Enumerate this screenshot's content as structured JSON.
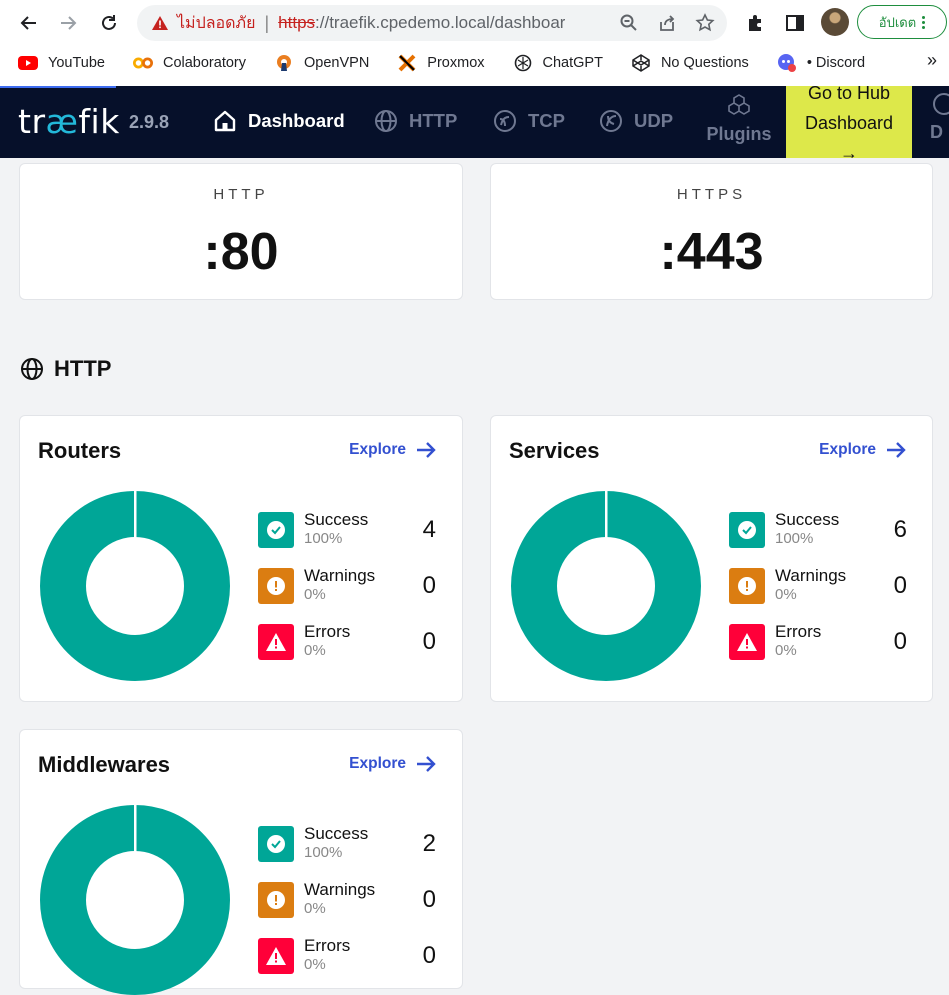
{
  "browser": {
    "insecure_label": "ไม่ปลอดภัย",
    "url_scheme": "https",
    "url_rest": "://traefik.cpedemo.local/dashboard...",
    "update_label": "อัปเดต",
    "bookmarks": [
      {
        "label": "YouTube",
        "icon": "youtube-icon"
      },
      {
        "label": "Colaboratory",
        "icon": "colab-icon"
      },
      {
        "label": "OpenVPN",
        "icon": "openvpn-icon"
      },
      {
        "label": "Proxmox",
        "icon": "proxmox-icon"
      },
      {
        "label": "ChatGPT",
        "icon": "chatgpt-icon"
      },
      {
        "label": "No Questions",
        "icon": "codepen-icon"
      },
      {
        "label": "• Discord",
        "icon": "discord-icon"
      }
    ],
    "bookmarks_more": "»"
  },
  "header": {
    "logo_pre": "tr",
    "logo_ae": "æ",
    "logo_post": "fik",
    "version": "2.9.8",
    "nav": {
      "dashboard": "Dashboard",
      "http": "HTTP",
      "tcp": "TCP",
      "udp": "UDP",
      "plugins": "Plugins"
    },
    "hub_line1": "Go to Hub",
    "hub_line2": "Dashboard",
    "hub_arrow": "→",
    "cut_label": "D"
  },
  "entrypoints": [
    {
      "name": "HTTP",
      "value": ":80"
    },
    {
      "name": "HTTPS",
      "value": ":443"
    }
  ],
  "section": {
    "title": "HTTP"
  },
  "explore_label": "Explore",
  "cards": {
    "routers": {
      "title": "Routers",
      "success": {
        "label": "Success",
        "pct": "100%",
        "count": "4"
      },
      "warnings": {
        "label": "Warnings",
        "pct": "0%",
        "count": "0"
      },
      "errors": {
        "label": "Errors",
        "pct": "0%",
        "count": "0"
      }
    },
    "services": {
      "title": "Services",
      "success": {
        "label": "Success",
        "pct": "100%",
        "count": "6"
      },
      "warnings": {
        "label": "Warnings",
        "pct": "0%",
        "count": "0"
      },
      "errors": {
        "label": "Errors",
        "pct": "0%",
        "count": "0"
      }
    },
    "middlewares": {
      "title": "Middlewares",
      "success": {
        "label": "Success",
        "pct": "100%",
        "count": "2"
      },
      "warnings": {
        "label": "Warnings",
        "pct": "0%",
        "count": "0"
      },
      "errors": {
        "label": "Errors",
        "pct": "0%",
        "count": "0"
      }
    }
  },
  "colors": {
    "success": "#00a697",
    "warning": "#db7d11",
    "error": "#ff0039",
    "header_bg": "#06102a",
    "hub_bg": "#dde84a",
    "explore": "#3350d0"
  }
}
